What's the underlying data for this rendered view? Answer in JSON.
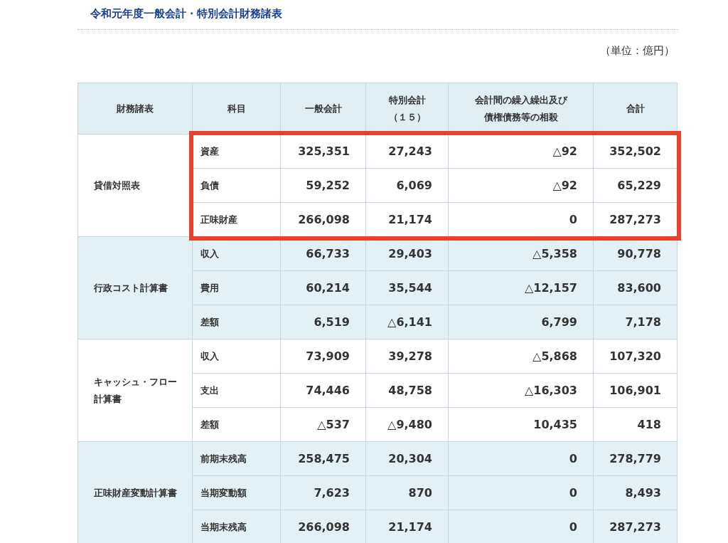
{
  "title": "令和元年度一般会計・特別会計財務諸表",
  "unit": "（単位：億円）",
  "columns": [
    [
      "財務諸表"
    ],
    [
      "科目"
    ],
    [
      "一般会計"
    ],
    [
      "特別会計",
      "（１５）"
    ],
    [
      "会計間の繰入繰出及び",
      "債権債務等の相殺"
    ],
    [
      "合計"
    ]
  ],
  "groups": [
    {
      "name": "貸借対照表",
      "highlighted": true,
      "rows": [
        {
          "item": "資産",
          "cells": [
            "325,351",
            "27,243",
            "△92",
            "352,502"
          ]
        },
        {
          "item": "負債",
          "cells": [
            "59,252",
            "6,069",
            "△92",
            "65,229"
          ]
        },
        {
          "item": "正味財産",
          "cells": [
            "266,098",
            "21,174",
            "0",
            "287,273"
          ]
        }
      ]
    },
    {
      "name": "行政コスト計算書",
      "highlighted": false,
      "rows": [
        {
          "item": "収入",
          "cells": [
            "66,733",
            "29,403",
            "△5,358",
            "90,778"
          ]
        },
        {
          "item": "費用",
          "cells": [
            "60,214",
            "35,544",
            "△12,157",
            "83,600"
          ]
        },
        {
          "item": "差額",
          "cells": [
            "6,519",
            "△6,141",
            "6,799",
            "7,178"
          ]
        }
      ]
    },
    {
      "name": "キャッシュ・フロー計算書",
      "highlighted": false,
      "rows": [
        {
          "item": "収入",
          "cells": [
            "73,909",
            "39,278",
            "△5,868",
            "107,320"
          ]
        },
        {
          "item": "支出",
          "cells": [
            "74,446",
            "48,758",
            "△16,303",
            "106,901"
          ]
        },
        {
          "item": "差額",
          "cells": [
            "△537",
            "△9,480",
            "10,435",
            "418"
          ]
        }
      ]
    },
    {
      "name": "正味財産変動計算書",
      "highlighted": false,
      "rows": [
        {
          "item": "前期末残高",
          "cells": [
            "258,475",
            "20,304",
            "0",
            "278,779"
          ]
        },
        {
          "item": "当期変動額",
          "cells": [
            "7,623",
            "870",
            "0",
            "8,493"
          ]
        },
        {
          "item": "当期末残高",
          "cells": [
            "266,098",
            "21,174",
            "0",
            "287,273"
          ]
        }
      ]
    }
  ]
}
